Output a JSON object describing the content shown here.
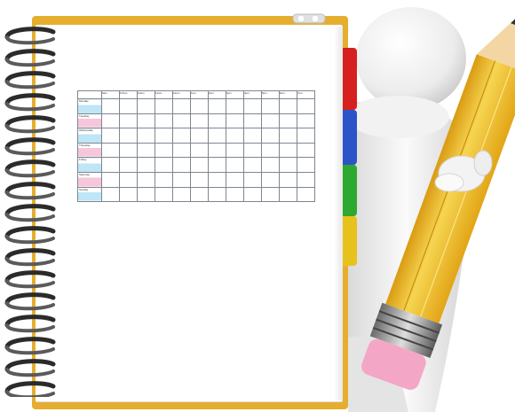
{
  "schedule": {
    "time_headers": [
      "9am",
      "9.5am",
      "10am",
      "11am",
      "12pm",
      "1pm",
      "2pm",
      "3pm",
      "4pm",
      "5pm",
      "6pm",
      "7pm"
    ],
    "days": [
      "Monday",
      "Tuesday",
      "Wednesday",
      "Thursday",
      "Friday",
      "Saturday",
      "Sunday"
    ]
  },
  "colors": {
    "notebook_cover": "#e6ae2e",
    "tab_red": "#d6201f",
    "tab_blue": "#2a54c8",
    "tab_green": "#2fa830",
    "tab_yellow": "#e8c21c",
    "day_pink": "#f7c6da",
    "day_blue": "#bfe6f7",
    "pencil_body": "#f1c232",
    "eraser": "#f4a6c6"
  },
  "illustration": {
    "figure": "3d-white-person-icon",
    "prop": "giant-pencil-icon",
    "object": "spiral-notebook-icon"
  }
}
